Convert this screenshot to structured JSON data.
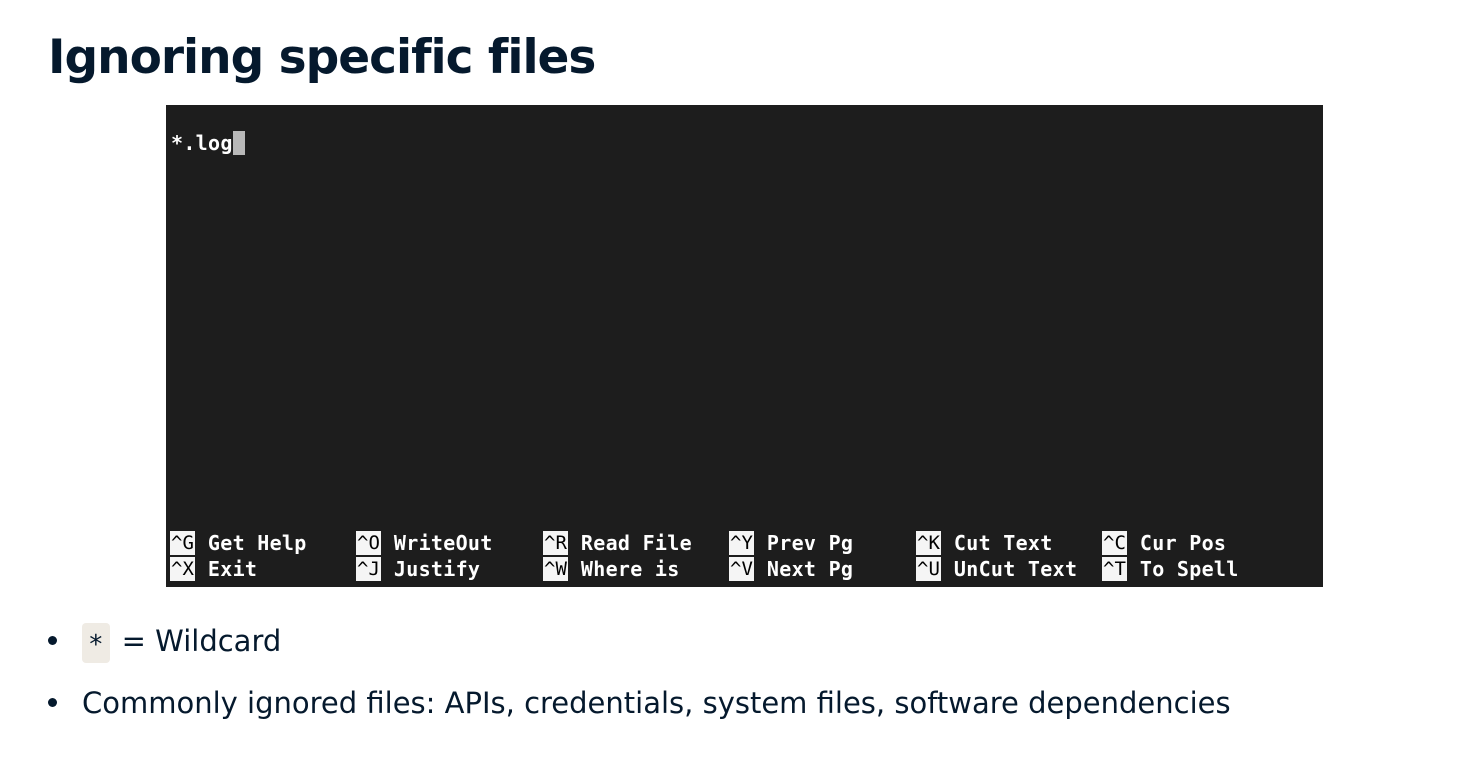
{
  "slide": {
    "title": "Ignoring specific files"
  },
  "editor": {
    "content": "*.log",
    "colors": {
      "background": "#1d1d1d",
      "text": "#ffffff",
      "cursor": "#b8b8b8",
      "key_highlight": "#f5f5f5"
    },
    "shortcuts": [
      [
        {
          "key": "^G",
          "label": "Get Help"
        },
        {
          "key": "^O",
          "label": "WriteOut"
        },
        {
          "key": "^R",
          "label": "Read File"
        },
        {
          "key": "^Y",
          "label": "Prev Pg"
        },
        {
          "key": "^K",
          "label": "Cut Text"
        },
        {
          "key": "^C",
          "label": "Cur Pos"
        }
      ],
      [
        {
          "key": "^X",
          "label": "Exit"
        },
        {
          "key": "^J",
          "label": "Justify"
        },
        {
          "key": "^W",
          "label": "Where is"
        },
        {
          "key": "^V",
          "label": "Next Pg"
        },
        {
          "key": "^U",
          "label": "UnCut Text"
        },
        {
          "key": "^T",
          "label": "To Spell"
        }
      ]
    ]
  },
  "bullets": {
    "items": [
      {
        "code": "*",
        "text": "= Wildcard"
      },
      {
        "text": "Commonly ignored files: APIs, credentials, system files, software dependencies"
      }
    ]
  }
}
